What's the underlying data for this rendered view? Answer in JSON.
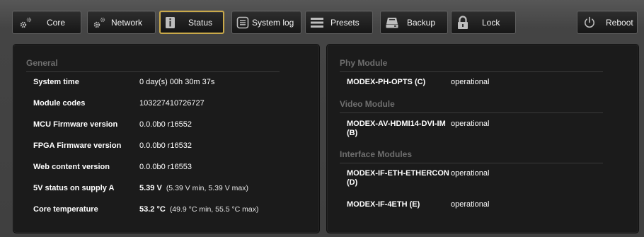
{
  "toolbar": {
    "core": "Core",
    "network": "Network",
    "status": "Status",
    "system_log": "System log",
    "presets": "Presets",
    "backup": "Backup",
    "lock": "Lock",
    "reboot": "Reboot",
    "active_tab": "Status",
    "active_color": "#c9a94a"
  },
  "general": {
    "title": "General",
    "rows": [
      {
        "label": "System time",
        "value": "0 day(s) 00h 30m 37s"
      },
      {
        "label": "Module codes",
        "value": "103227410726727"
      },
      {
        "label": "MCU Firmware version",
        "value": "0.0.0b0 r16552"
      },
      {
        "label": "FPGA Firmware version",
        "value": "0.0.0b0 r16532"
      },
      {
        "label": "Web content version",
        "value": "0.0.0b0 r16553"
      },
      {
        "label": "5V status on supply A",
        "value": "5.39 V",
        "detail": "(5.39 V min, 5.39 V max)"
      },
      {
        "label": "Core temperature",
        "value": "53.2 °C",
        "detail": "(49.9 °C min, 55.5 °C max)"
      }
    ]
  },
  "phy_module": {
    "title": "Phy Module",
    "items": [
      {
        "label": "MODEX-PH-OPTS (C)",
        "status": "operational"
      }
    ]
  },
  "video_module": {
    "title": "Video Module",
    "items": [
      {
        "label": "MODEX-AV-HDMI14-DVI-IM (B)",
        "status": "operational"
      }
    ]
  },
  "interface_modules": {
    "title": "Interface Modules",
    "items": [
      {
        "label": "MODEX-IF-ETH-ETHERCON (D)",
        "status": "operational"
      },
      {
        "label": "MODEX-IF-4ETH (E)",
        "status": "operational"
      }
    ]
  }
}
